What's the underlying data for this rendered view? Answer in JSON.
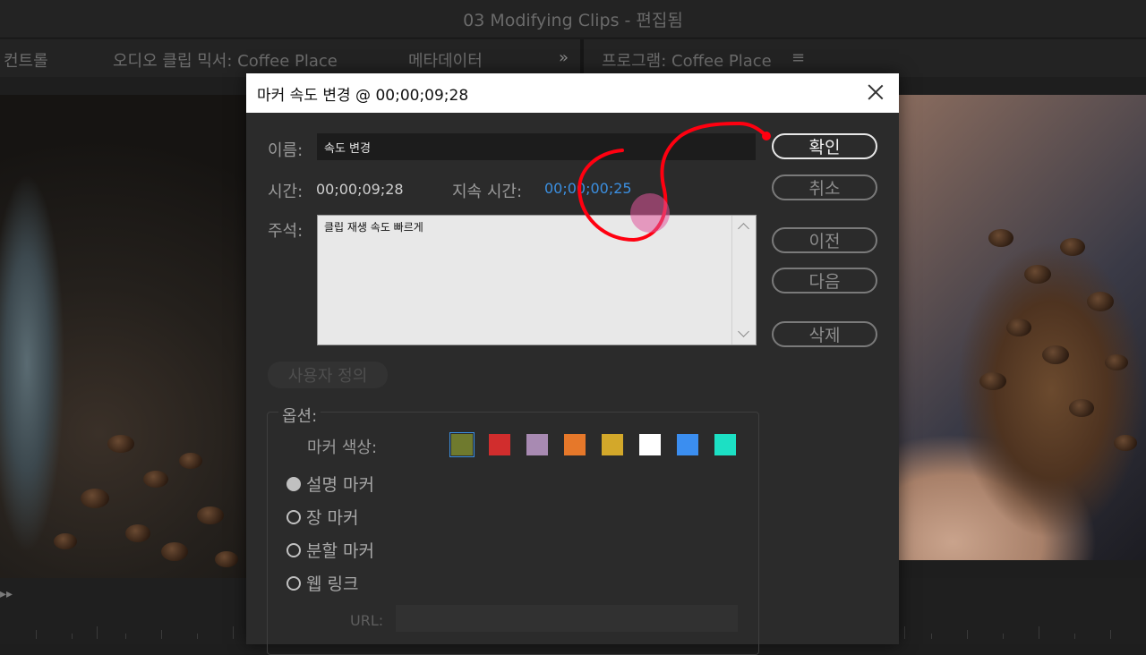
{
  "window": {
    "title": "03 Modifying Clips - 편집됨"
  },
  "panels": {
    "controls": "컨트롤",
    "audio_mixer": "오디오 클립 믹서: Coffee Place",
    "metadata": "메타데이터",
    "overflow": "»",
    "program": "프로그램: Coffee Place",
    "menu": "≡"
  },
  "dialog": {
    "title": "마커 속도 변경 @ 00;00;09;28",
    "name_label": "이름:",
    "name_value": "속도 변경",
    "time_label": "시간:",
    "time_value": "00;00;09;28",
    "duration_label": "지속 시간:",
    "duration_value": "00;00;00;25",
    "comment_label": "주석:",
    "comment_value": "클립 재생 속도 빠르게",
    "buttons": {
      "ok": "확인",
      "cancel": "취소",
      "prev": "이전",
      "next": "다음",
      "delete": "삭제"
    },
    "custom_label": "사용자 정의",
    "options_label": "옵션:",
    "marker_color_label": "마커 색상:",
    "colors": [
      "#6f7a2e",
      "#d12d2d",
      "#a88ab2",
      "#e6782a",
      "#d3a82a",
      "#ffffff",
      "#3b8ef0",
      "#1ce0c4"
    ],
    "selected_color": 0,
    "marker_types": [
      "설명 마커",
      "장 마커",
      "분할 마커",
      "웹 링크"
    ],
    "selected_type": 0,
    "url_label": "URL:",
    "url_value": ""
  },
  "annotation": {
    "color": "#ff0010",
    "cursor_color": "#e0569b"
  }
}
